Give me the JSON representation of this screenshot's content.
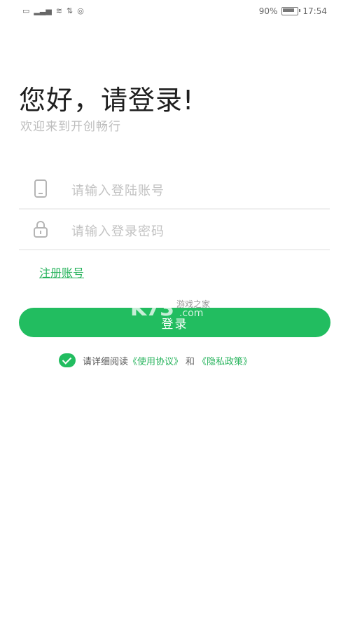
{
  "status_bar": {
    "left_icons": [
      "sim-icon",
      "signal-icon",
      "wifi-icon",
      "data-icon",
      "notification-icon"
    ],
    "battery": "90%",
    "time": "17:54"
  },
  "header": {
    "title": "您好，请登录!",
    "subtitle": "欢迎来到开创畅行"
  },
  "form": {
    "account_placeholder": "请输入登陆账号",
    "password_placeholder": "请输入登录密码",
    "register_link": "注册账号",
    "login_button": "登录"
  },
  "agreement": {
    "prefix": "请详细阅读",
    "terms": "《使用协议》",
    "and": "和",
    "privacy": "《隐私政策》"
  },
  "watermark": {
    "logo": "K73",
    "site_name": "游戏之家",
    "domain": ".com"
  },
  "colors": {
    "accent": "#22bd60",
    "link": "#27b35c",
    "placeholder": "#c3c3c3"
  }
}
